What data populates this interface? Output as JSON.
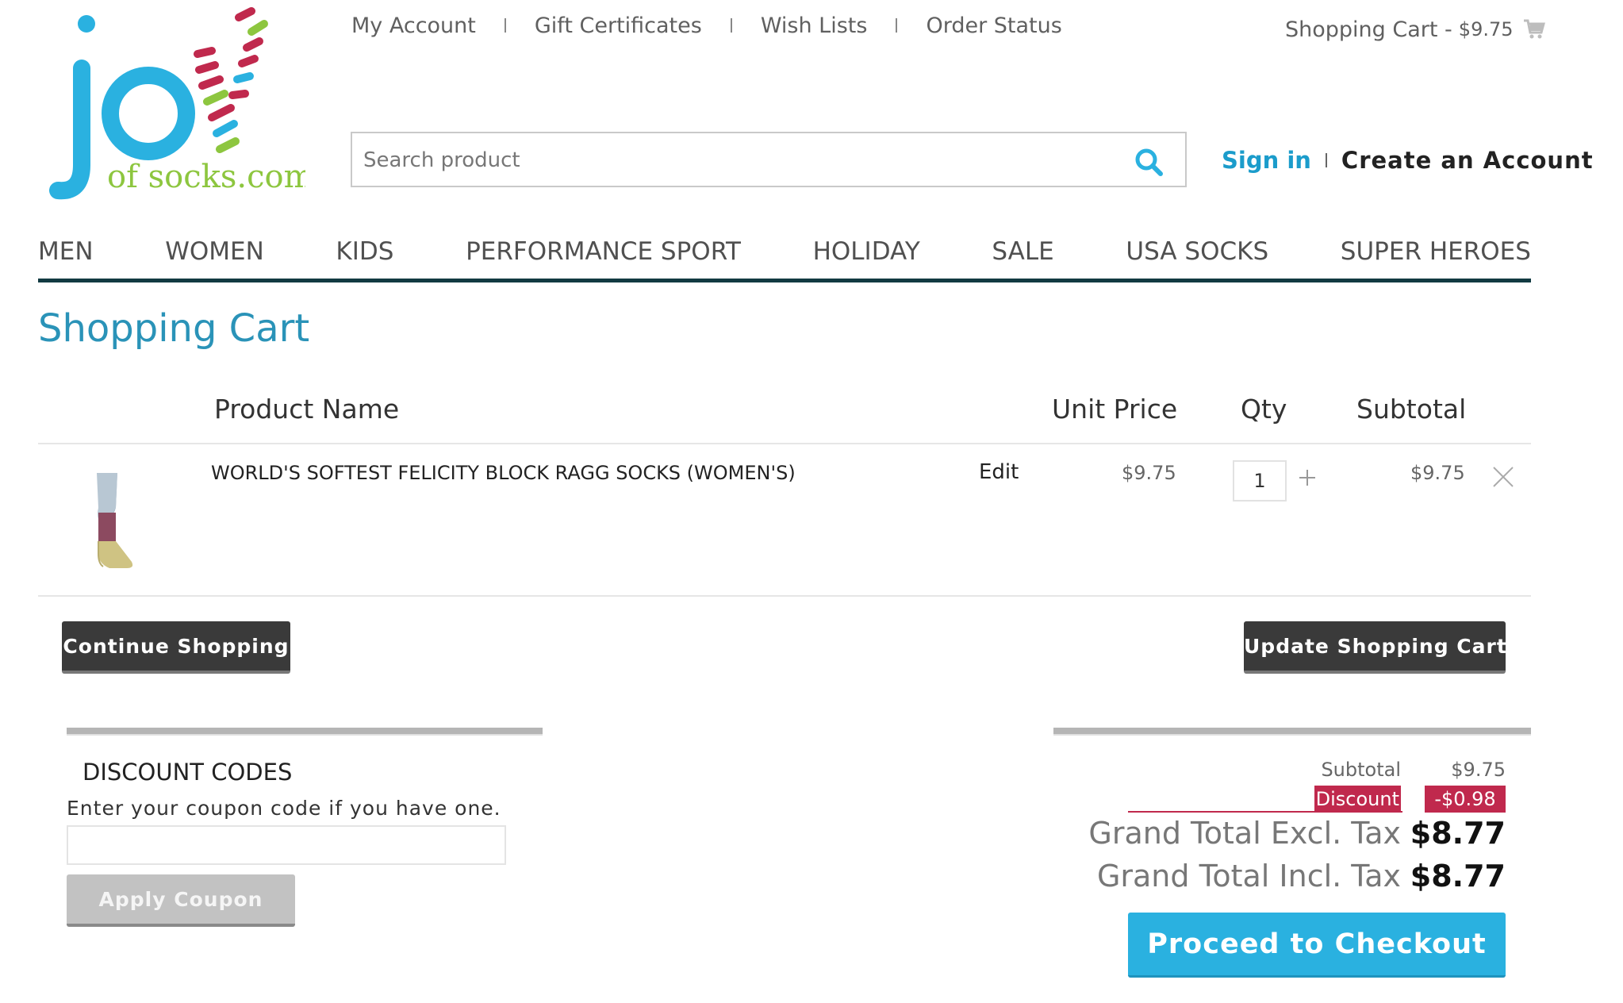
{
  "logo": {
    "letters": "jo",
    "domain": "of socks.com"
  },
  "top_links": [
    "My Account",
    "Gift Certificates",
    "Wish Lists",
    "Order Status"
  ],
  "cart_summary": {
    "label": "Shopping Cart -",
    "amount": "$9.75",
    "icon": "cart-icon"
  },
  "search": {
    "placeholder": "Search product",
    "icon": "search-icon"
  },
  "auth": {
    "sign_in": "Sign in",
    "create_account": "Create an Account"
  },
  "nav": [
    "MEN",
    "WOMEN",
    "KIDS",
    "PERFORMANCE SPORT",
    "HOLIDAY",
    "SALE",
    "USA SOCKS",
    "SUPER HEROES"
  ],
  "page_title": "Shopping Cart",
  "table": {
    "headers": {
      "product": "Product Name",
      "unit_price": "Unit Price",
      "qty": "Qty",
      "subtotal": "Subtotal"
    },
    "rows": [
      {
        "name": "WORLD'S SOFTEST FELICITY BLOCK RAGG SOCKS (WOMEN'S)",
        "edit": "Edit",
        "unit_price": "$9.75",
        "qty": "1",
        "subtotal": "$9.75"
      }
    ]
  },
  "buttons": {
    "continue": "Continue Shopping",
    "update": "Update Shopping Cart",
    "apply": "Apply Coupon",
    "checkout": "Proceed to Checkout"
  },
  "discount": {
    "title": "DISCOUNT CODES",
    "help": "Enter your coupon code if you have one.",
    "input_value": ""
  },
  "totals": {
    "subtotal_label": "Subtotal",
    "subtotal": "$9.75",
    "discount_label": "Discount",
    "discount": "-$0.98",
    "excl_label": "Grand Total Excl. Tax",
    "excl": "$8.77",
    "incl_label": "Grand Total Incl. Tax",
    "incl": "$8.77"
  },
  "colors": {
    "accent": "#2a93b8",
    "checkout": "#2ab1e0",
    "discount": "#c0294d",
    "nav_rule": "#123a42"
  }
}
